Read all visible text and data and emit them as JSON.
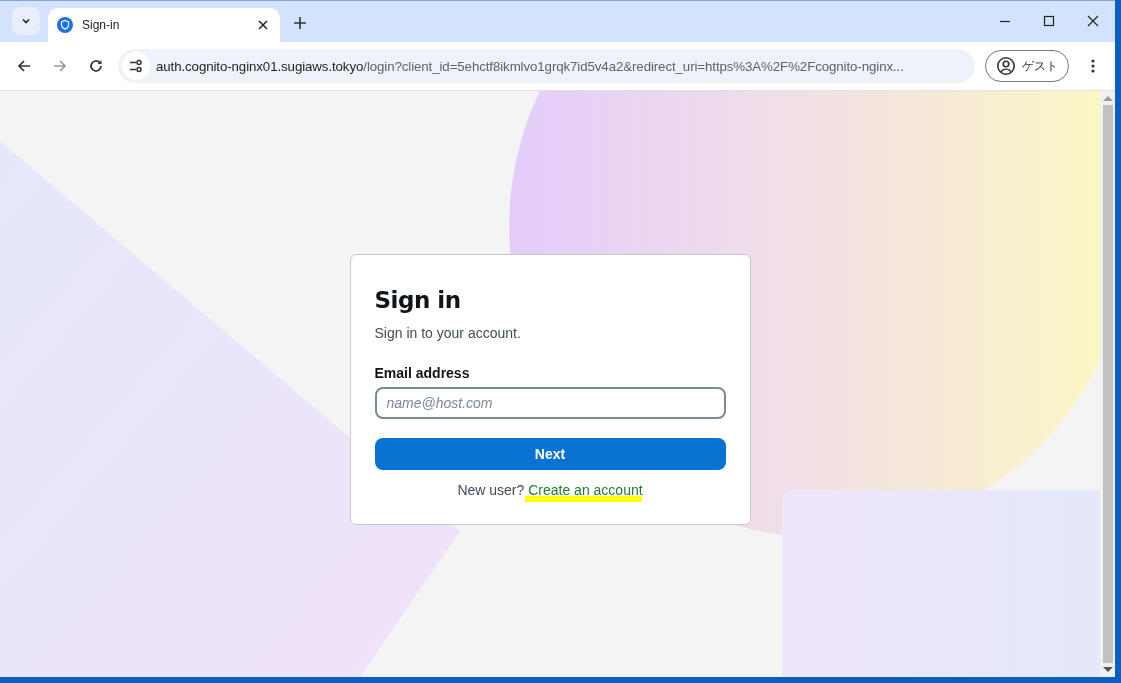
{
  "browser": {
    "tabs": [
      {
        "title": "Sign-in",
        "selected": true
      }
    ],
    "url": {
      "host": "auth.cognito-nginx01.sugiaws.tokyo",
      "path": "/login?client_id=5ehctf8ikmlvo1grqk7id5v4a2&redirect_uri=https%3A%2F%2Fcognito-nginx..."
    },
    "profile_label": "ゲスト"
  },
  "card": {
    "title": "Sign in",
    "subtitle": "Sign in to your account.",
    "email": {
      "label": "Email address",
      "placeholder": "name@host.com"
    },
    "next_button": "Next",
    "signup_prompt": "New user?",
    "signup_link": {
      "label": "Create an account",
      "highlighted": true
    }
  }
}
